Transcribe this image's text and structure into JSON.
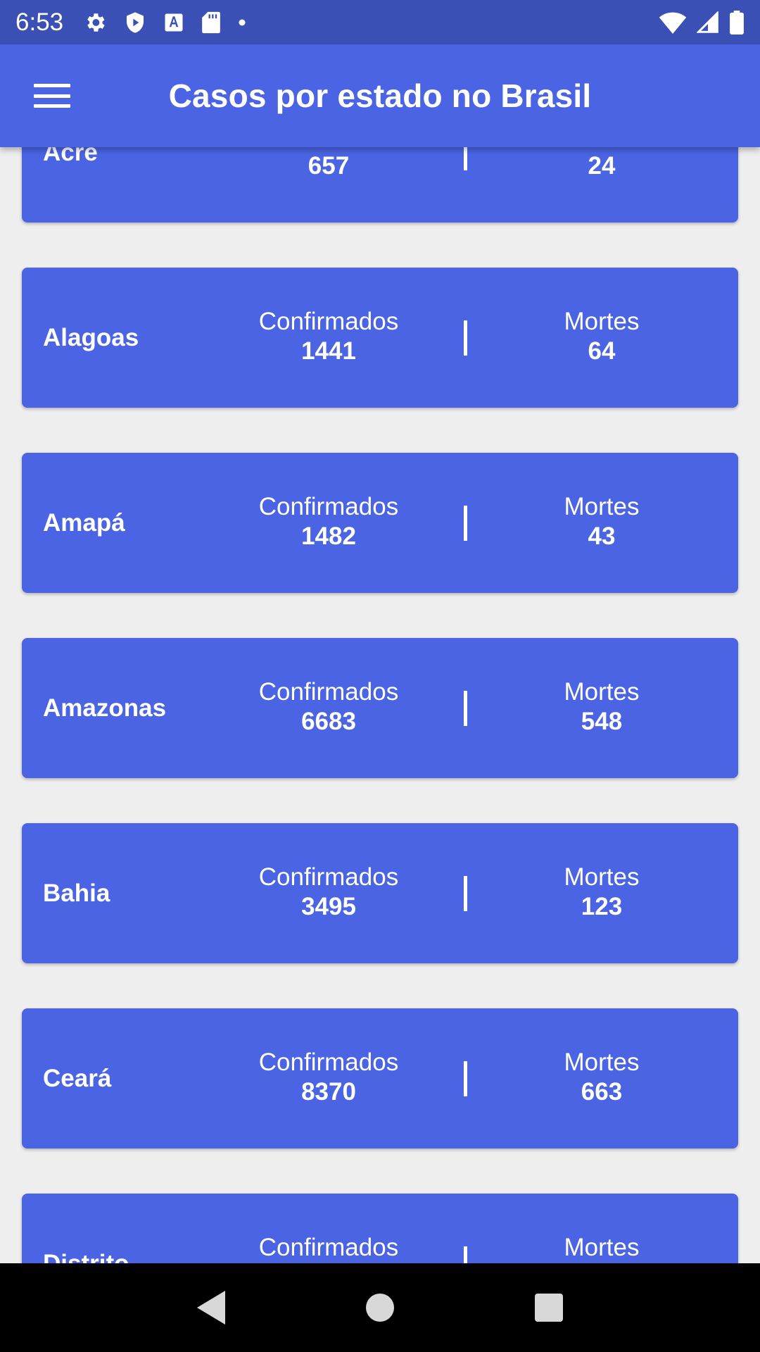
{
  "status_bar": {
    "time": "6:53",
    "icons_left": [
      "gear-icon",
      "shield-play-icon",
      "font-a-icon",
      "sd-card-icon",
      "dot-icon"
    ],
    "icons_right": [
      "wifi-icon",
      "signal-icon",
      "battery-icon"
    ]
  },
  "app_bar": {
    "title": "Casos por estado no Brasil",
    "menu_icon": "hamburger-menu-icon"
  },
  "labels": {
    "confirmed": "Confirmados",
    "deaths": "Mortes"
  },
  "states": [
    {
      "name": "Acre",
      "confirmed": "657",
      "deaths": "24"
    },
    {
      "name": "Alagoas",
      "confirmed": "1441",
      "deaths": "64"
    },
    {
      "name": "Amapá",
      "confirmed": "1482",
      "deaths": "43"
    },
    {
      "name": "Amazonas",
      "confirmed": "6683",
      "deaths": "548"
    },
    {
      "name": "Bahia",
      "confirmed": "3495",
      "deaths": "123"
    },
    {
      "name": "Ceará",
      "confirmed": "8370",
      "deaths": "663"
    },
    {
      "name": "Distrito",
      "confirmed": "",
      "deaths": ""
    }
  ],
  "colors": {
    "status_bar": "#3a50b5",
    "app_bar": "#4a64e3",
    "card": "#4a64e3",
    "background": "#eeeeee"
  }
}
